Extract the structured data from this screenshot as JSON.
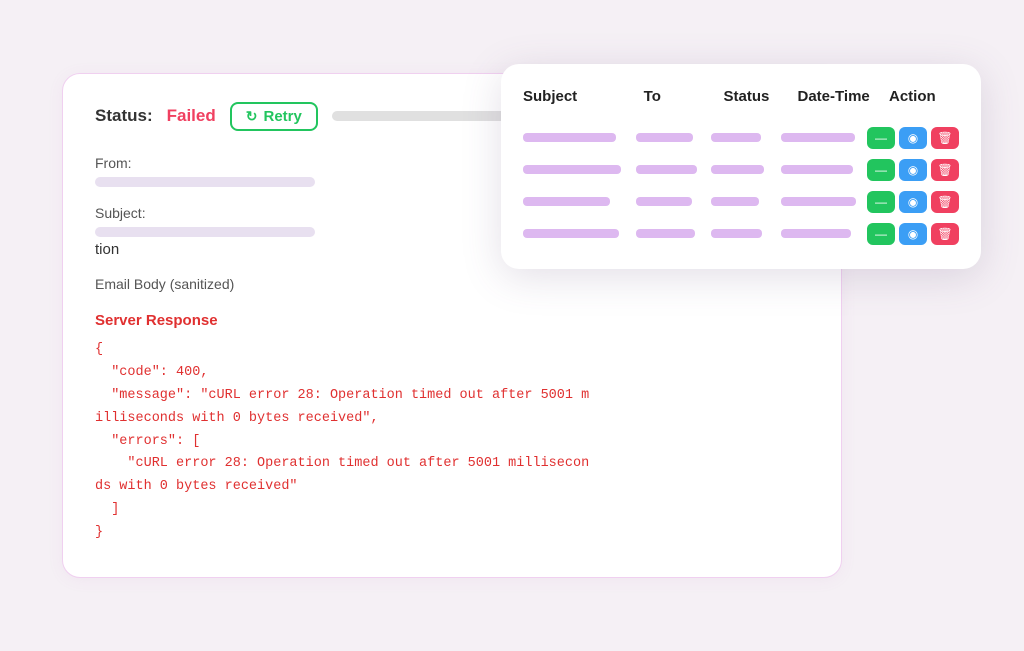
{
  "status": {
    "label": "Status:",
    "value": "Failed",
    "retry_label": "Retry"
  },
  "form": {
    "from_label": "From:",
    "subject_label": "Subject:",
    "subject_value": "tion",
    "email_body_label": "Email Body (sanitized)"
  },
  "server_response": {
    "title": "Server Response",
    "code": "{\n  \"code\": 400,\n  \"message\": \"cURL error 28: Operation timed out after 5001 m\nilliseconds with 0 bytes received\",\n  \"errors\": [\n    \"cURL error 28: Operation timed out after 5001 millisecon\nds with 0 bytes received\"\n  ]\n}"
  },
  "table": {
    "headers": [
      "Subject",
      "To",
      "Status",
      "Date-Time",
      "Action"
    ],
    "rows": [
      {
        "subject_width": "85%",
        "to_width": "80%",
        "status_width": "75%",
        "datetime_width": "90%"
      },
      {
        "subject_width": "90%",
        "to_width": "85%",
        "status_width": "80%",
        "datetime_width": "88%"
      },
      {
        "subject_width": "80%",
        "to_width": "78%",
        "status_width": "72%",
        "datetime_width": "92%"
      },
      {
        "subject_width": "88%",
        "to_width": "82%",
        "status_width": "77%",
        "datetime_width": "85%"
      }
    ]
  },
  "icons": {
    "retry": "↻",
    "action_resend": "—",
    "action_view": "👁",
    "action_delete": "🗑"
  }
}
